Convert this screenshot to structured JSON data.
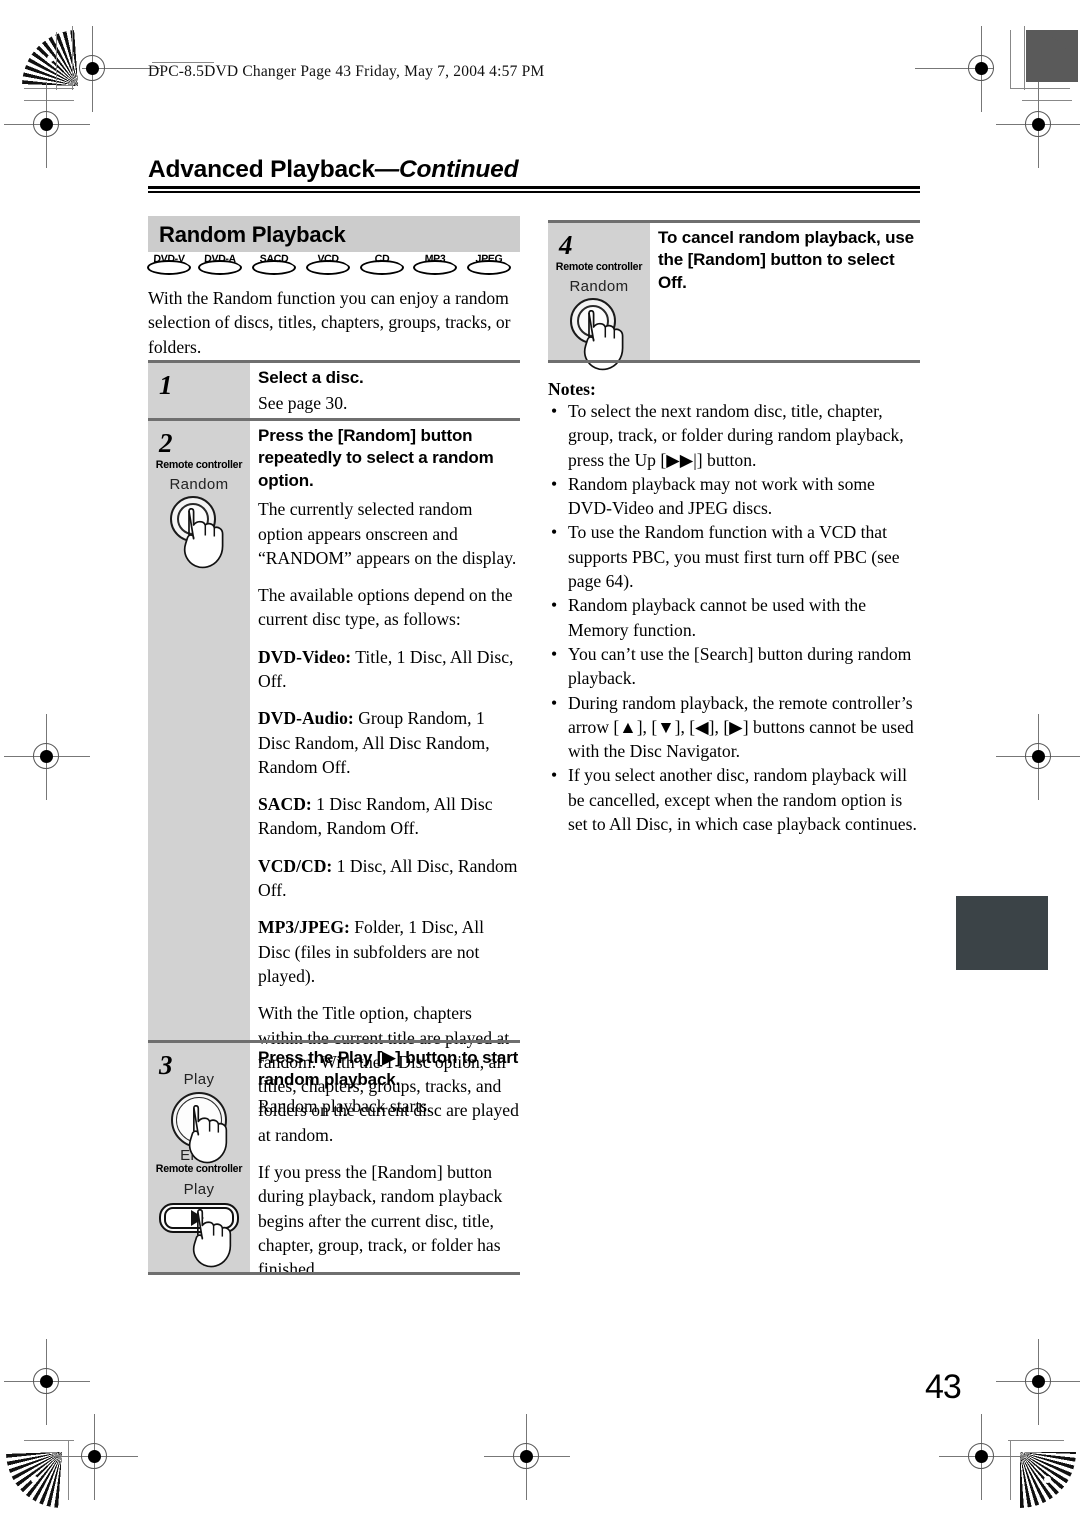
{
  "print_header": {
    "text": "DPC-8.5DVD Changer  Page 43  Friday, May 7, 2004  4:57 PM"
  },
  "chapter": {
    "title": "Advanced Playback",
    "continued": "—Continued"
  },
  "section": {
    "title": "Random Playback",
    "badges": [
      {
        "label": "DVD-V"
      },
      {
        "label": "DVD-A"
      },
      {
        "label": "SACD"
      },
      {
        "label": "VCD"
      },
      {
        "label": "CD"
      },
      {
        "label": "MP3"
      },
      {
        "label": "JPEG"
      }
    ],
    "intro": "With the Random function you can enjoy a random selection of discs, titles, chapters, groups, tracks, or folders."
  },
  "steps": [
    {
      "number": "1",
      "heading": "Select a disc.",
      "body": [
        "See page 30."
      ]
    },
    {
      "number": "2",
      "remote_label": "Remote controller",
      "button_caption": "Random",
      "heading": "Press the [Random] button repeatedly to select a random option.",
      "body": [
        "The currently selected random option appears onscreen and “RANDOM” appears on the display.",
        "The available options depend on the current disc type, as follows:"
      ],
      "disc_options": [
        {
          "type": "DVD-Video:",
          "values": " Title, 1 Disc, All Disc, Off."
        },
        {
          "type": "DVD-Audio:",
          "values": " Group Random, 1 Disc Random, All Disc Random, Random Off."
        },
        {
          "type": "SACD:",
          "values": " 1 Disc Random, All Disc Random, Random Off."
        },
        {
          "type": "VCD/CD:",
          "values": " 1 Disc, All Disc, Random Off."
        },
        {
          "type": "MP3/JPEG:",
          "values": " Folder, 1 Disc, All Disc (files in subfolders are not played)."
        }
      ],
      "body_after": [
        "With the Title option, chapters within the current title are played at random. With the 1 Disc option, all titles, chapters, groups, tracks, and folders on the current disc are played at random.",
        "If you press the [Random] button during playback, random playback begins after the current disc, title, chapter, group, track, or folder has finished."
      ]
    },
    {
      "number": "3",
      "remote_label": "Remote controller",
      "dial_top_caption": "Play",
      "dial_bottom_caption": "Enter",
      "button_caption": "Play",
      "heading": "Press the Play [▶] button to start random playback.",
      "body": [
        "Random playback starts."
      ]
    },
    {
      "number": "4",
      "remote_label": "Remote controller",
      "button_caption": "Random",
      "heading": "To cancel random playback, use the [Random] button to select Off.",
      "body": []
    }
  ],
  "notes": {
    "title": "Notes:",
    "items": [
      "To select the next random disc, title, chapter, group, track, or folder during random playback, press the Up [▶▶|] button.",
      "Random playback may not work with some DVD-Video and JPEG discs.",
      "To use the Random function with a VCD that supports PBC, you must first turn off PBC (see page 64).",
      "Random playback cannot be used with the Memory function.",
      "You can’t use the [Search] button during random playback.",
      "During random playback, the remote controller’s arrow [▲], [▼], [◀], [▶] buttons cannot be used with the Disc Navigator.",
      "If you select another disc, random playback will be cancelled, except when the random option is set to All Disc, in which case playback continues."
    ]
  },
  "page_number": "43",
  "colors": {
    "section_band": "#cccccc",
    "step_column": "#d2d2d2",
    "rule": "#000000",
    "thumb_tab": "#3b4347"
  }
}
